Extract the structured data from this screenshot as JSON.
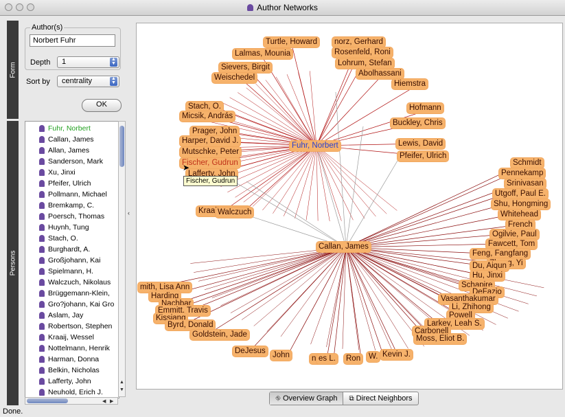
{
  "window": {
    "title": "Author Networks"
  },
  "sidetabs": {
    "form": "Form",
    "persons": "Persons"
  },
  "form": {
    "authors_label": "Author(s)",
    "author_value": "Norbert Fuhr",
    "depth_label": "Depth",
    "depth_value": "1",
    "sort_label": "Sort by",
    "sort_value": "centrality",
    "ok_label": "OK"
  },
  "persons": [
    "Fuhr, Norbert",
    "Callan, James",
    "Allan, James",
    "Sanderson, Mark",
    "Xu, Jinxi",
    "Pfeifer, Ulrich",
    "Pollmann, Michael",
    "Bremkamp, C.",
    "Poersch, Thomas",
    "Huynh, Tung",
    "Stach, O.",
    "Burghardt, A.",
    "Großjohann, Kai",
    "Spielmann, H.",
    "Walczuch, Nikolaus",
    "Brüggemann-Klein,",
    "Gro?johann, Kai Gro",
    "Aslam, Jay",
    "Robertson, Stephen",
    "Kraaij, Wessel",
    "Nottelmann, Henrik",
    "Harman, Donna",
    "Belkin, Nicholas",
    "Lafferty, John",
    "Neuhold, Erich J."
  ],
  "persons_selected_color": "#22a020",
  "graph": {
    "hub1": "Fuhr, Norbert",
    "hub2": "Callan, James",
    "tooltip": "Fischer, Gudrun",
    "left_nodes": [
      "Turtle, Howard",
      "norz, Gerhard",
      "Rosenfeld, Roni",
      "Lalmas, Mounia",
      "Lohrum, Stefan",
      "Abolhassani",
      "Sievers, Birgit",
      "Weischedel",
      "Hiemstra",
      "Stach, O.",
      "Hofmann",
      "Micsik, András",
      "Buckley, Chris",
      "Prager, John",
      "Harper, David J.",
      "Lewis, David",
      "Mutschke, Peter",
      "Pfeifer, Ulrich",
      "Fischer, Gudrun",
      "Lafferty, John",
      "Kraaij, Wessel",
      "Walczuch"
    ],
    "right_nodes": [
      "Schmidt",
      "Pennekamp",
      "Srinivasan",
      "Utgoff, Paul E.",
      "Shu, Hongming",
      "Whitehead",
      "French",
      "Ogilvie, Paul",
      "Fawcett, Tom",
      "Feng, Fangfang",
      "Zhang, Yi",
      "Du, Aiqun",
      "Hu, Jinxi",
      "Schapire",
      "DeFazio",
      "Vasanthakumar",
      "Li, Zhihong",
      "Powell",
      "Larkey, Leah S.",
      "Carbonell",
      "Moss, Eliot B."
    ],
    "bottom_nodes": [
      "mith, Lisa Ann",
      "Harding",
      "Nachbar",
      "Emmitt, Travis",
      "Kissiang",
      "Byrd, Donald",
      "Goldstein, Jade",
      "DeJesus",
      "John",
      "niella",
      "es L.",
      "Ron",
      "W.",
      "Kevin J."
    ]
  },
  "view_tabs": {
    "overview": "Overview Graph",
    "neighbors": "Direct Neighbors"
  },
  "status": "Done."
}
